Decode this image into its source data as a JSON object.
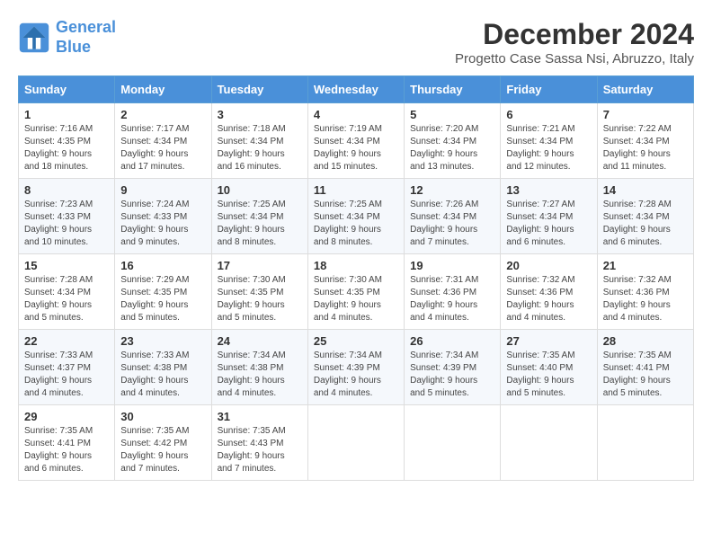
{
  "header": {
    "logo_general": "General",
    "logo_blue": "Blue",
    "main_title": "December 2024",
    "subtitle": "Progetto Case Sassa Nsi, Abruzzo, Italy"
  },
  "calendar": {
    "days_of_week": [
      "Sunday",
      "Monday",
      "Tuesday",
      "Wednesday",
      "Thursday",
      "Friday",
      "Saturday"
    ],
    "weeks": [
      [
        null,
        {
          "day": "2",
          "sunrise": "Sunrise: 7:17 AM",
          "sunset": "Sunset: 4:34 PM",
          "daylight": "Daylight: 9 hours and 17 minutes."
        },
        {
          "day": "3",
          "sunrise": "Sunrise: 7:18 AM",
          "sunset": "Sunset: 4:34 PM",
          "daylight": "Daylight: 9 hours and 16 minutes."
        },
        {
          "day": "4",
          "sunrise": "Sunrise: 7:19 AM",
          "sunset": "Sunset: 4:34 PM",
          "daylight": "Daylight: 9 hours and 15 minutes."
        },
        {
          "day": "5",
          "sunrise": "Sunrise: 7:20 AM",
          "sunset": "Sunset: 4:34 PM",
          "daylight": "Daylight: 9 hours and 13 minutes."
        },
        {
          "day": "6",
          "sunrise": "Sunrise: 7:21 AM",
          "sunset": "Sunset: 4:34 PM",
          "daylight": "Daylight: 9 hours and 12 minutes."
        },
        {
          "day": "7",
          "sunrise": "Sunrise: 7:22 AM",
          "sunset": "Sunset: 4:34 PM",
          "daylight": "Daylight: 9 hours and 11 minutes."
        }
      ],
      [
        {
          "day": "1",
          "sunrise": "Sunrise: 7:16 AM",
          "sunset": "Sunset: 4:35 PM",
          "daylight": "Daylight: 9 hours and 18 minutes."
        },
        {
          "day": "8",
          "sunrise": "Sunrise: 7:23 AM",
          "sunset": "Sunset: 4:33 PM",
          "daylight": "Daylight: 9 hours and 10 minutes."
        },
        {
          "day": "9",
          "sunrise": "Sunrise: 7:24 AM",
          "sunset": "Sunset: 4:33 PM",
          "daylight": "Daylight: 9 hours and 9 minutes."
        },
        {
          "day": "10",
          "sunrise": "Sunrise: 7:25 AM",
          "sunset": "Sunset: 4:34 PM",
          "daylight": "Daylight: 9 hours and 8 minutes."
        },
        {
          "day": "11",
          "sunrise": "Sunrise: 7:25 AM",
          "sunset": "Sunset: 4:34 PM",
          "daylight": "Daylight: 9 hours and 8 minutes."
        },
        {
          "day": "12",
          "sunrise": "Sunrise: 7:26 AM",
          "sunset": "Sunset: 4:34 PM",
          "daylight": "Daylight: 9 hours and 7 minutes."
        },
        {
          "day": "13",
          "sunrise": "Sunrise: 7:27 AM",
          "sunset": "Sunset: 4:34 PM",
          "daylight": "Daylight: 9 hours and 6 minutes."
        },
        {
          "day": "14",
          "sunrise": "Sunrise: 7:28 AM",
          "sunset": "Sunset: 4:34 PM",
          "daylight": "Daylight: 9 hours and 6 minutes."
        }
      ],
      [
        {
          "day": "15",
          "sunrise": "Sunrise: 7:28 AM",
          "sunset": "Sunset: 4:34 PM",
          "daylight": "Daylight: 9 hours and 5 minutes."
        },
        {
          "day": "16",
          "sunrise": "Sunrise: 7:29 AM",
          "sunset": "Sunset: 4:35 PM",
          "daylight": "Daylight: 9 hours and 5 minutes."
        },
        {
          "day": "17",
          "sunrise": "Sunrise: 7:30 AM",
          "sunset": "Sunset: 4:35 PM",
          "daylight": "Daylight: 9 hours and 5 minutes."
        },
        {
          "day": "18",
          "sunrise": "Sunrise: 7:30 AM",
          "sunset": "Sunset: 4:35 PM",
          "daylight": "Daylight: 9 hours and 4 minutes."
        },
        {
          "day": "19",
          "sunrise": "Sunrise: 7:31 AM",
          "sunset": "Sunset: 4:36 PM",
          "daylight": "Daylight: 9 hours and 4 minutes."
        },
        {
          "day": "20",
          "sunrise": "Sunrise: 7:32 AM",
          "sunset": "Sunset: 4:36 PM",
          "daylight": "Daylight: 9 hours and 4 minutes."
        },
        {
          "day": "21",
          "sunrise": "Sunrise: 7:32 AM",
          "sunset": "Sunset: 4:36 PM",
          "daylight": "Daylight: 9 hours and 4 minutes."
        }
      ],
      [
        {
          "day": "22",
          "sunrise": "Sunrise: 7:33 AM",
          "sunset": "Sunset: 4:37 PM",
          "daylight": "Daylight: 9 hours and 4 minutes."
        },
        {
          "day": "23",
          "sunrise": "Sunrise: 7:33 AM",
          "sunset": "Sunset: 4:38 PM",
          "daylight": "Daylight: 9 hours and 4 minutes."
        },
        {
          "day": "24",
          "sunrise": "Sunrise: 7:34 AM",
          "sunset": "Sunset: 4:38 PM",
          "daylight": "Daylight: 9 hours and 4 minutes."
        },
        {
          "day": "25",
          "sunrise": "Sunrise: 7:34 AM",
          "sunset": "Sunset: 4:39 PM",
          "daylight": "Daylight: 9 hours and 4 minutes."
        },
        {
          "day": "26",
          "sunrise": "Sunrise: 7:34 AM",
          "sunset": "Sunset: 4:39 PM",
          "daylight": "Daylight: 9 hours and 5 minutes."
        },
        {
          "day": "27",
          "sunrise": "Sunrise: 7:35 AM",
          "sunset": "Sunset: 4:40 PM",
          "daylight": "Daylight: 9 hours and 5 minutes."
        },
        {
          "day": "28",
          "sunrise": "Sunrise: 7:35 AM",
          "sunset": "Sunset: 4:41 PM",
          "daylight": "Daylight: 9 hours and 5 minutes."
        }
      ],
      [
        {
          "day": "29",
          "sunrise": "Sunrise: 7:35 AM",
          "sunset": "Sunset: 4:41 PM",
          "daylight": "Daylight: 9 hours and 6 minutes."
        },
        {
          "day": "30",
          "sunrise": "Sunrise: 7:35 AM",
          "sunset": "Sunset: 4:42 PM",
          "daylight": "Daylight: 9 hours and 7 minutes."
        },
        {
          "day": "31",
          "sunrise": "Sunrise: 7:35 AM",
          "sunset": "Sunset: 4:43 PM",
          "daylight": "Daylight: 9 hours and 7 minutes."
        },
        null,
        null,
        null,
        null
      ]
    ]
  }
}
